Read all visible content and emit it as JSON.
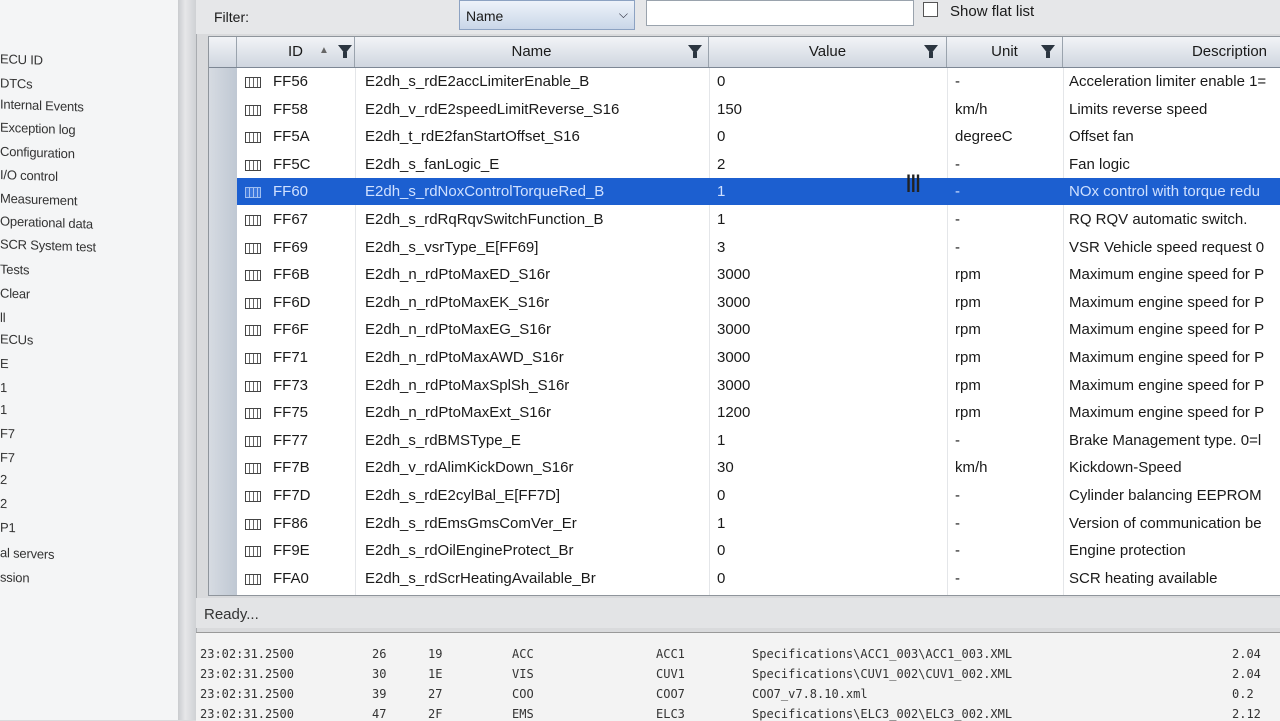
{
  "nav": {
    "items": [
      "ECU ID",
      "DTCs",
      "Internal Events",
      "Exception log",
      "Configuration",
      "I/O control",
      "Measurement",
      "Operational data",
      "SCR System test",
      "Tests",
      "Clear",
      "ll",
      "ECUs",
      "E",
      "1",
      "1",
      "F7",
      "F7",
      "2",
      "2",
      "P1",
      "al servers",
      "ssion"
    ]
  },
  "filter": {
    "label": "Filter:",
    "selected": "Name",
    "text_value": "",
    "flat_label": "Show flat list",
    "flat_checked": false
  },
  "grid": {
    "columns": [
      "ID",
      "Name",
      "Value",
      "Unit",
      "Description"
    ],
    "selected_index": 4,
    "rows": [
      {
        "id": "FF56",
        "name": "E2dh_s_rdE2accLimiterEnable_B",
        "value": "0",
        "unit": "-",
        "desc": "Acceleration limiter enable 1="
      },
      {
        "id": "FF58",
        "name": "E2dh_v_rdE2speedLimitReverse_S16",
        "value": "150",
        "unit": "km/h",
        "desc": "Limits reverse speed"
      },
      {
        "id": "FF5A",
        "name": "E2dh_t_rdE2fanStartOffset_S16",
        "value": "0",
        "unit": "degreeC",
        "desc": "Offset fan"
      },
      {
        "id": "FF5C",
        "name": "E2dh_s_fanLogic_E",
        "value": "2",
        "unit": "-",
        "desc": "Fan logic"
      },
      {
        "id": "FF60",
        "name": "E2dh_s_rdNoxControlTorqueRed_B",
        "value": "1",
        "unit": "-",
        "desc": "NOx control with torque redu"
      },
      {
        "id": "FF67",
        "name": "E2dh_s_rdRqRqvSwitchFunction_B",
        "value": "1",
        "unit": "-",
        "desc": "RQ RQV automatic switch."
      },
      {
        "id": "FF69",
        "name": "E2dh_s_vsrType_E[FF69]",
        "value": "3",
        "unit": "-",
        "desc": "VSR Vehicle speed request 0"
      },
      {
        "id": "FF6B",
        "name": "E2dh_n_rdPtoMaxED_S16r",
        "value": "3000",
        "unit": "rpm",
        "desc": "Maximum engine speed for P"
      },
      {
        "id": "FF6D",
        "name": "E2dh_n_rdPtoMaxEK_S16r",
        "value": "3000",
        "unit": "rpm",
        "desc": "Maximum engine speed for P"
      },
      {
        "id": "FF6F",
        "name": "E2dh_n_rdPtoMaxEG_S16r",
        "value": "3000",
        "unit": "rpm",
        "desc": "Maximum engine speed for P"
      },
      {
        "id": "FF71",
        "name": "E2dh_n_rdPtoMaxAWD_S16r",
        "value": "3000",
        "unit": "rpm",
        "desc": "Maximum engine speed for P"
      },
      {
        "id": "FF73",
        "name": "E2dh_n_rdPtoMaxSplSh_S16r",
        "value": "3000",
        "unit": "rpm",
        "desc": "Maximum engine speed for P"
      },
      {
        "id": "FF75",
        "name": "E2dh_n_rdPtoMaxExt_S16r",
        "value": "1200",
        "unit": "rpm",
        "desc": "Maximum engine speed for P"
      },
      {
        "id": "FF77",
        "name": "E2dh_s_rdBMSType_E",
        "value": "1",
        "unit": "-",
        "desc": "Brake Management type. 0=l"
      },
      {
        "id": "FF7B",
        "name": "E2dh_v_rdAlimKickDown_S16r",
        "value": "30",
        "unit": "km/h",
        "desc": "Kickdown-Speed"
      },
      {
        "id": "FF7D",
        "name": "E2dh_s_rdE2cylBal_E[FF7D]",
        "value": "0",
        "unit": "-",
        "desc": "Cylinder balancing EEPROM"
      },
      {
        "id": "FF86",
        "name": "E2dh_s_rdEmsGmsComVer_Er",
        "value": "1",
        "unit": "-",
        "desc": "Version of communication be"
      },
      {
        "id": "FF9E",
        "name": "E2dh_s_rdOilEngineProtect_Br",
        "value": "0",
        "unit": "-",
        "desc": "Engine protection"
      },
      {
        "id": "FFA0",
        "name": "E2dh_s_rdScrHeatingAvailable_Br",
        "value": "0",
        "unit": "-",
        "desc": "SCR heating available"
      }
    ]
  },
  "status": {
    "text": "Ready..."
  },
  "log": {
    "lines": [
      {
        "time": "23:02:31.2500",
        "a": "26",
        "b": "19",
        "code": "ACC",
        "ecu": "ACC1",
        "path": "Specifications\\ACC1_003\\ACC1_003.XML",
        "ver": "2.04"
      },
      {
        "time": "23:02:31.2500",
        "a": "30",
        "b": "1E",
        "code": "VIS",
        "ecu": "CUV1",
        "path": "Specifications\\CUV1_002\\CUV1_002.XML",
        "ver": "2.04"
      },
      {
        "time": "23:02:31.2500",
        "a": "39",
        "b": "27",
        "code": "COO",
        "ecu": "COO7",
        "path": "COO7_v7.8.10.xml",
        "ver": "0.2"
      },
      {
        "time": "23:02:31.2500",
        "a": "47",
        "b": "2F",
        "code": "EMS",
        "ecu": "ELC3",
        "path": "Specifications\\ELC3_002\\ELC3_002.XML",
        "ver": "2.12"
      }
    ]
  }
}
